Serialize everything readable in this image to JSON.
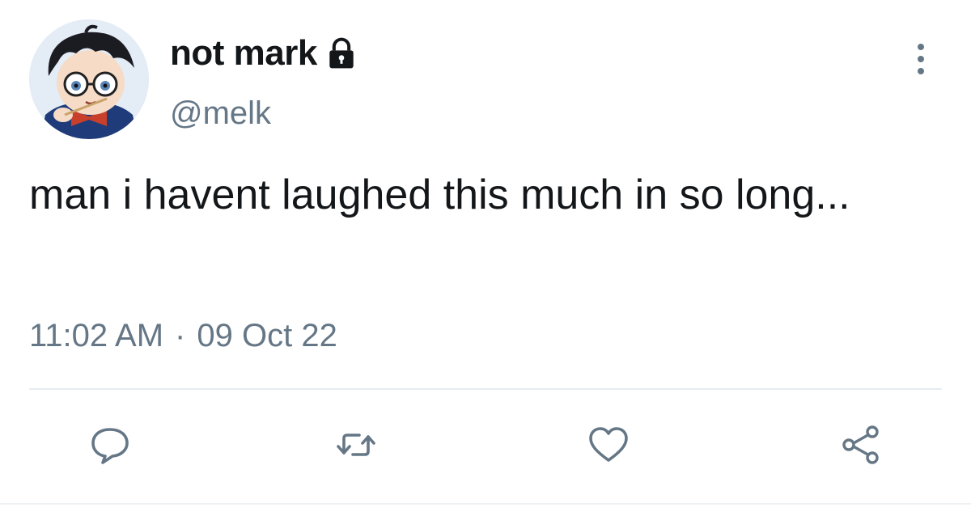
{
  "user": {
    "display_name": "not mark",
    "handle": "@melk",
    "avatar_icon": "avatar-image",
    "protected_icon": "lock-icon"
  },
  "tweet": {
    "text": "man i havent laughed this much in so long...",
    "time": "11:02 AM",
    "separator": "·",
    "date": "09 Oct 22"
  },
  "actions": {
    "more_icon": "more-vertical-icon",
    "reply_icon": "reply-icon",
    "retweet_icon": "retweet-icon",
    "like_icon": "heart-icon",
    "share_icon": "share-icon"
  },
  "colors": {
    "text": "#14171a",
    "secondary": "#657786",
    "divider": "#e6ecf0"
  }
}
